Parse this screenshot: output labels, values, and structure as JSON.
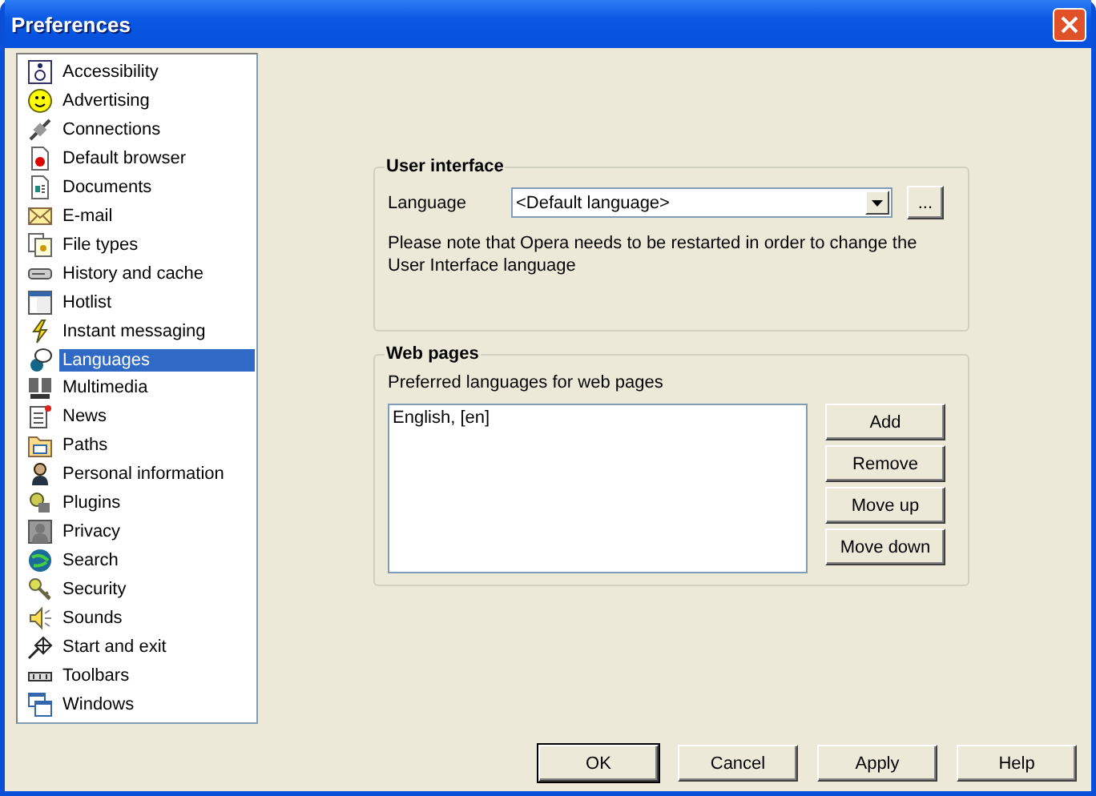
{
  "window": {
    "title": "Preferences"
  },
  "sidebar": {
    "items": [
      {
        "label": "Accessibility",
        "selected": false
      },
      {
        "label": "Advertising",
        "selected": false
      },
      {
        "label": "Connections",
        "selected": false
      },
      {
        "label": "Default browser",
        "selected": false
      },
      {
        "label": "Documents",
        "selected": false
      },
      {
        "label": "E-mail",
        "selected": false
      },
      {
        "label": "File types",
        "selected": false
      },
      {
        "label": "History and cache",
        "selected": false
      },
      {
        "label": "Hotlist",
        "selected": false
      },
      {
        "label": "Instant messaging",
        "selected": false
      },
      {
        "label": "Languages",
        "selected": true
      },
      {
        "label": "Multimedia",
        "selected": false
      },
      {
        "label": "News",
        "selected": false
      },
      {
        "label": "Paths",
        "selected": false
      },
      {
        "label": "Personal information",
        "selected": false
      },
      {
        "label": "Plugins",
        "selected": false
      },
      {
        "label": "Privacy",
        "selected": false
      },
      {
        "label": "Search",
        "selected": false
      },
      {
        "label": "Security",
        "selected": false
      },
      {
        "label": "Sounds",
        "selected": false
      },
      {
        "label": "Start and exit",
        "selected": false
      },
      {
        "label": "Toolbars",
        "selected": false
      },
      {
        "label": "Windows",
        "selected": false
      }
    ]
  },
  "user_interface": {
    "title": "User interface",
    "language_label": "Language",
    "language_value": "<Default language>",
    "browse_button": "...",
    "note": "Please note that Opera needs to be restarted in order to change the User Interface language"
  },
  "web_pages": {
    "title": "Web pages",
    "list_label": "Preferred languages for web pages",
    "languages": [
      "English, [en]"
    ],
    "buttons": [
      "Add",
      "Remove",
      "Move up",
      "Move down"
    ]
  },
  "buttons": [
    "OK",
    "Cancel",
    "Apply",
    "Help"
  ]
}
